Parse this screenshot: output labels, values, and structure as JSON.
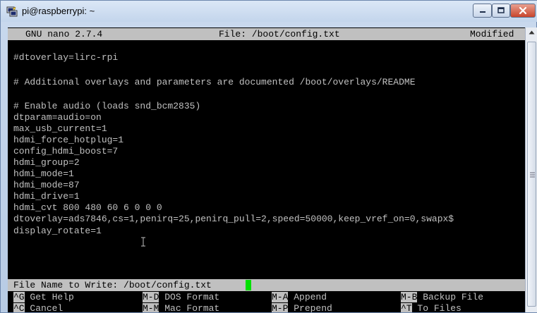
{
  "window": {
    "title": "pi@raspberrypi: ~"
  },
  "nano": {
    "version": "GNU nano 2.7.4",
    "file_label": "File: /boot/config.txt",
    "status": "Modified",
    "lines": [
      "#dtoverlay=lirc-rpi",
      "",
      "# Additional overlays and parameters are documented /boot/overlays/README",
      "",
      "# Enable audio (loads snd_bcm2835)",
      "dtparam=audio=on",
      "max_usb_current=1",
      "hdmi_force_hotplug=1",
      "config_hdmi_boost=7",
      "hdmi_group=2",
      "hdmi_mode=1",
      "hdmi_mode=87",
      "hdmi_drive=1",
      "hdmi_cvt 800 480 60 6 0 0 0",
      "dtoverlay=ads7846,cs=1,penirq=25,penirq_pull=2,speed=50000,keep_vref_on=0,swapx$",
      "display_rotate=1"
    ],
    "prompt": "File Name to Write: /boot/config.txt",
    "shortcuts": [
      {
        "key": "^G",
        "label": "Get Help"
      },
      {
        "key": "M-D",
        "label": "DOS Format"
      },
      {
        "key": "M-A",
        "label": "Append"
      },
      {
        "key": "M-B",
        "label": "Backup File"
      },
      {
        "key": "^C",
        "label": "Cancel"
      },
      {
        "key": "M-M",
        "label": "Mac Format"
      },
      {
        "key": "M-P",
        "label": "Prepend"
      },
      {
        "key": "^T",
        "label": "To Files"
      }
    ]
  },
  "colors": {
    "terminal_bg": "#000000",
    "terminal_fg": "#c0c0c0",
    "cursor": "#00e000",
    "bar": "#c0c0c0"
  }
}
